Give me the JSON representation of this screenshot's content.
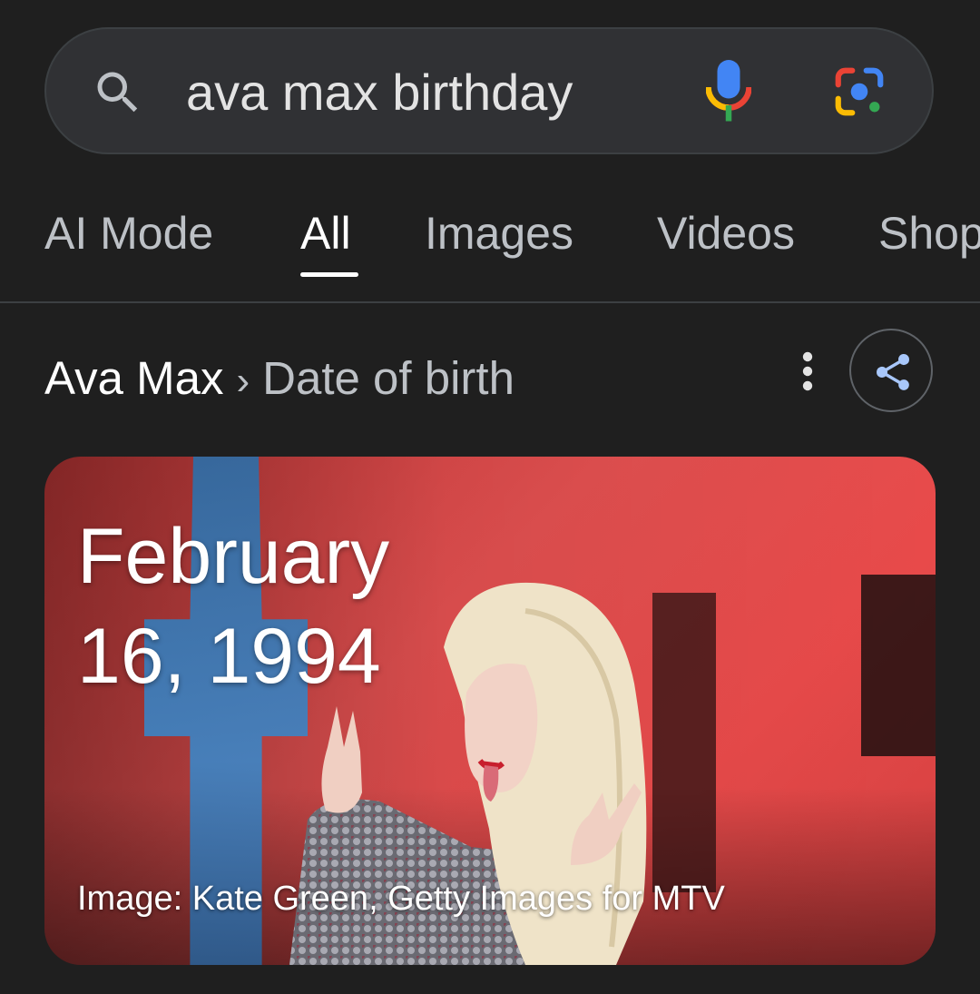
{
  "search": {
    "query": "ava max birthday",
    "icons": {
      "search": "search-icon",
      "voice": "microphone-icon",
      "lens": "google-lens-icon"
    }
  },
  "tabs": [
    {
      "label": "AI Mode",
      "active": false
    },
    {
      "label": "All",
      "active": true
    },
    {
      "label": "Images",
      "active": false
    },
    {
      "label": "Videos",
      "active": false
    },
    {
      "label": "Shop",
      "active": false
    }
  ],
  "breadcrumb": {
    "entity": "Ava Max",
    "separator": "›",
    "attribute": "Date of birth"
  },
  "answer": {
    "date_line1": "February",
    "date_line2": "16, 1994",
    "caption": "Image: Kate Green, Getty Images for MTV"
  },
  "colors": {
    "background": "#1f1f1f",
    "search_bg": "#303134",
    "card_red": "#e25050",
    "google_blue": "#4285f4",
    "google_red": "#ea4335",
    "google_yellow": "#fbbc04",
    "google_green": "#34a853"
  }
}
